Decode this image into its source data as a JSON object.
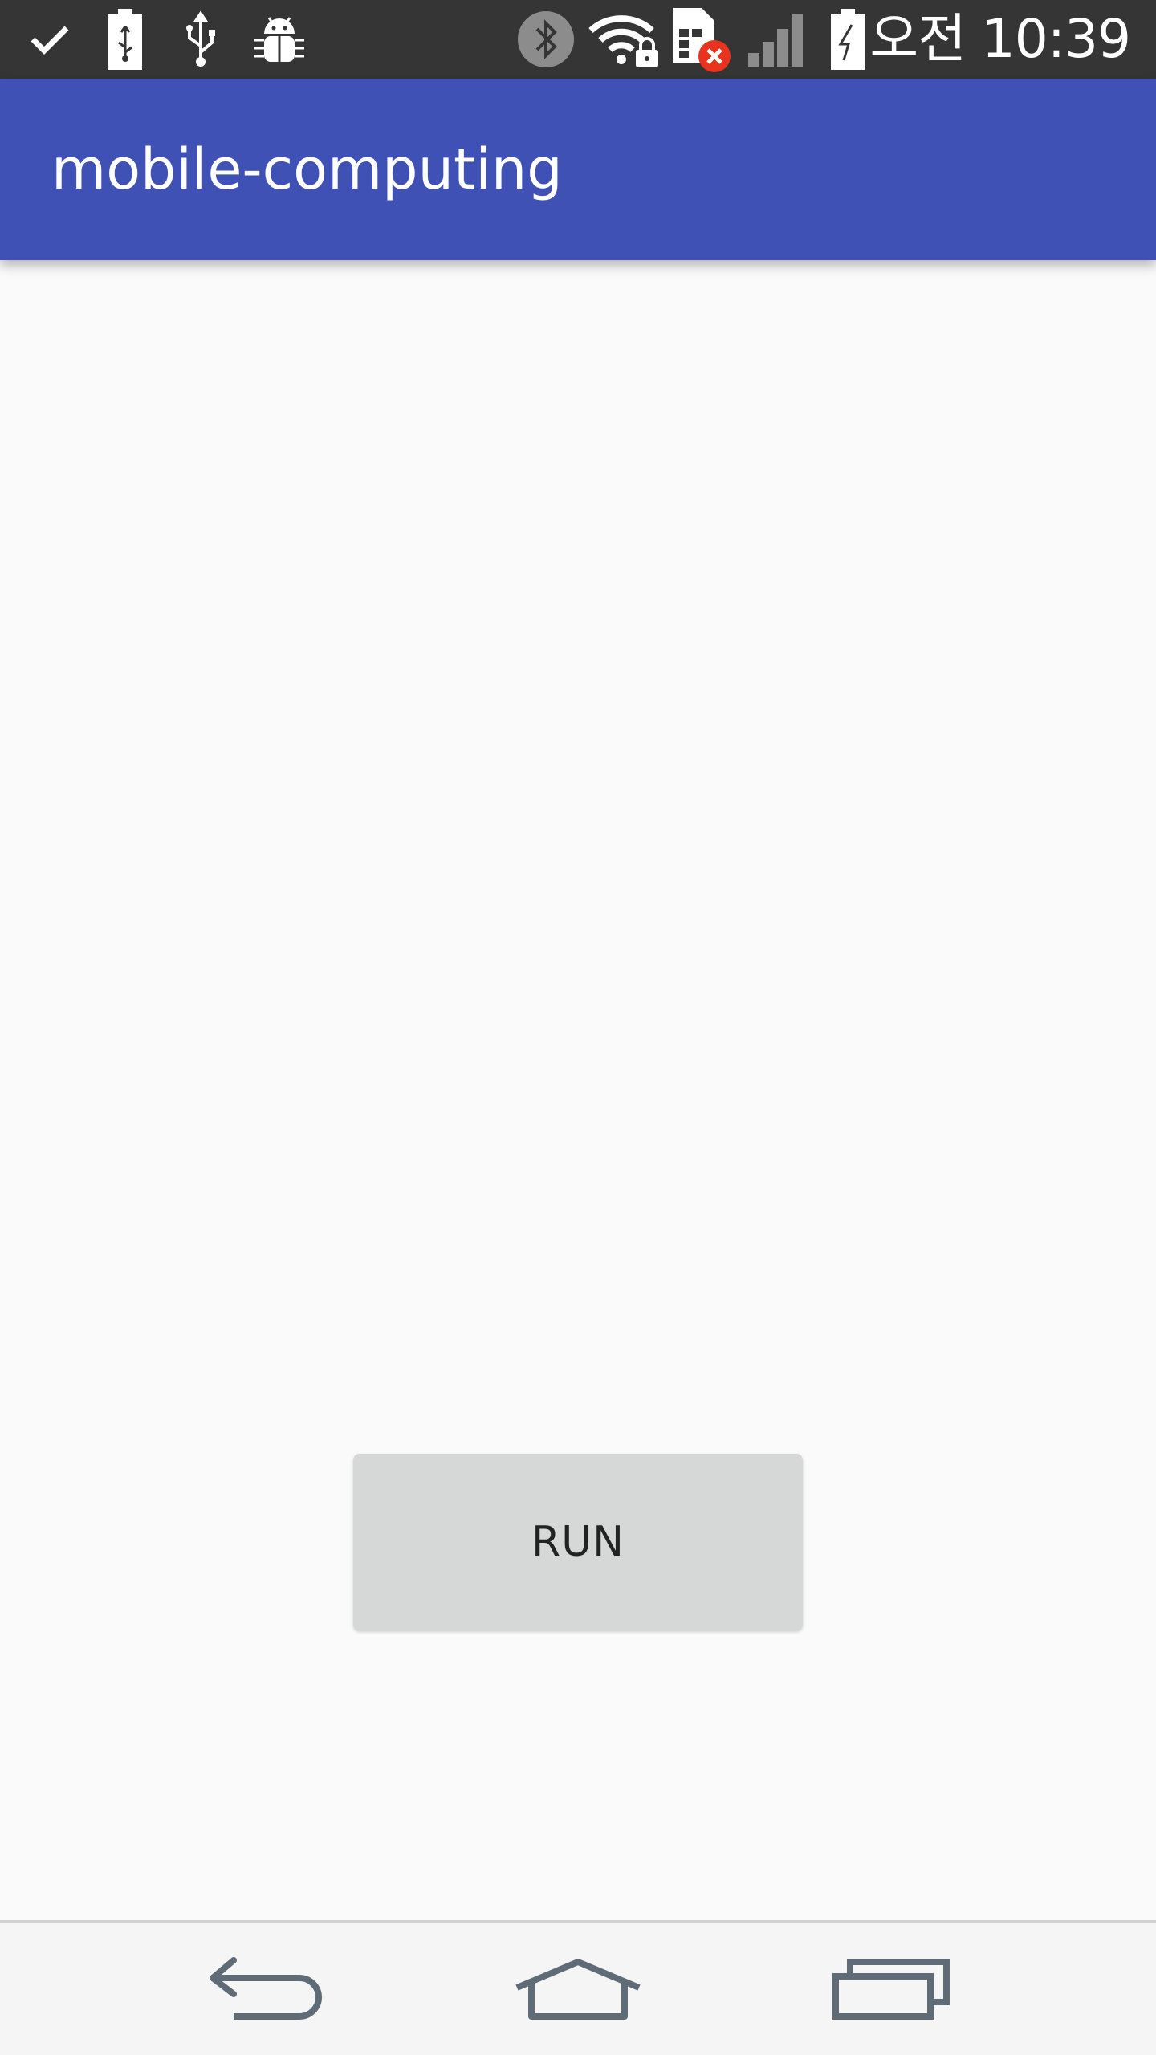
{
  "status_bar": {
    "time": "오전 10:39",
    "left_icons": [
      "check-icon",
      "battery-usb-icon",
      "usb-icon",
      "android-debug-icon"
    ],
    "right_icons": [
      "bluetooth-icon",
      "wifi-locked-icon",
      "sim-error-icon",
      "signal-icon",
      "battery-charging-icon"
    ]
  },
  "app_bar": {
    "title": "mobile-computing",
    "color": "#3f51b5"
  },
  "main": {
    "run_button_label": "RUN"
  },
  "nav_bar": {
    "buttons": [
      "back-icon",
      "home-icon",
      "recents-icon"
    ]
  }
}
